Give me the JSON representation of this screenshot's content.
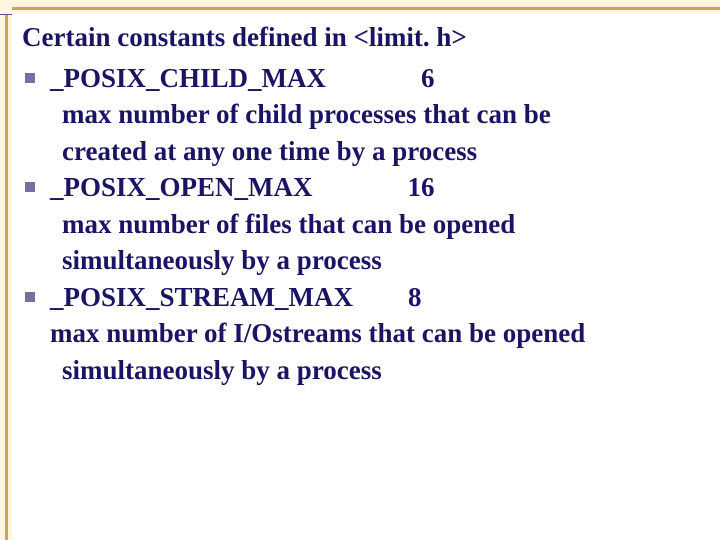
{
  "title": "Certain constants defined in <limit. h>",
  "items": [
    {
      "name": "_POSIX_CHILD_MAX",
      "value": "6",
      "desc1": "max number of child processes that can be",
      "desc2": "created at any one time by a process"
    },
    {
      "name": "_POSIX_OPEN_MAX",
      "value": "16",
      "desc1": "max number of files that can be opened",
      "desc2": "simultaneously by a process"
    },
    {
      "name": "_POSIX_STREAM_MAX",
      "value": "8",
      "desc1": "max number of I/Ostreams that can be opened",
      "desc2": "simultaneously by a process"
    }
  ]
}
